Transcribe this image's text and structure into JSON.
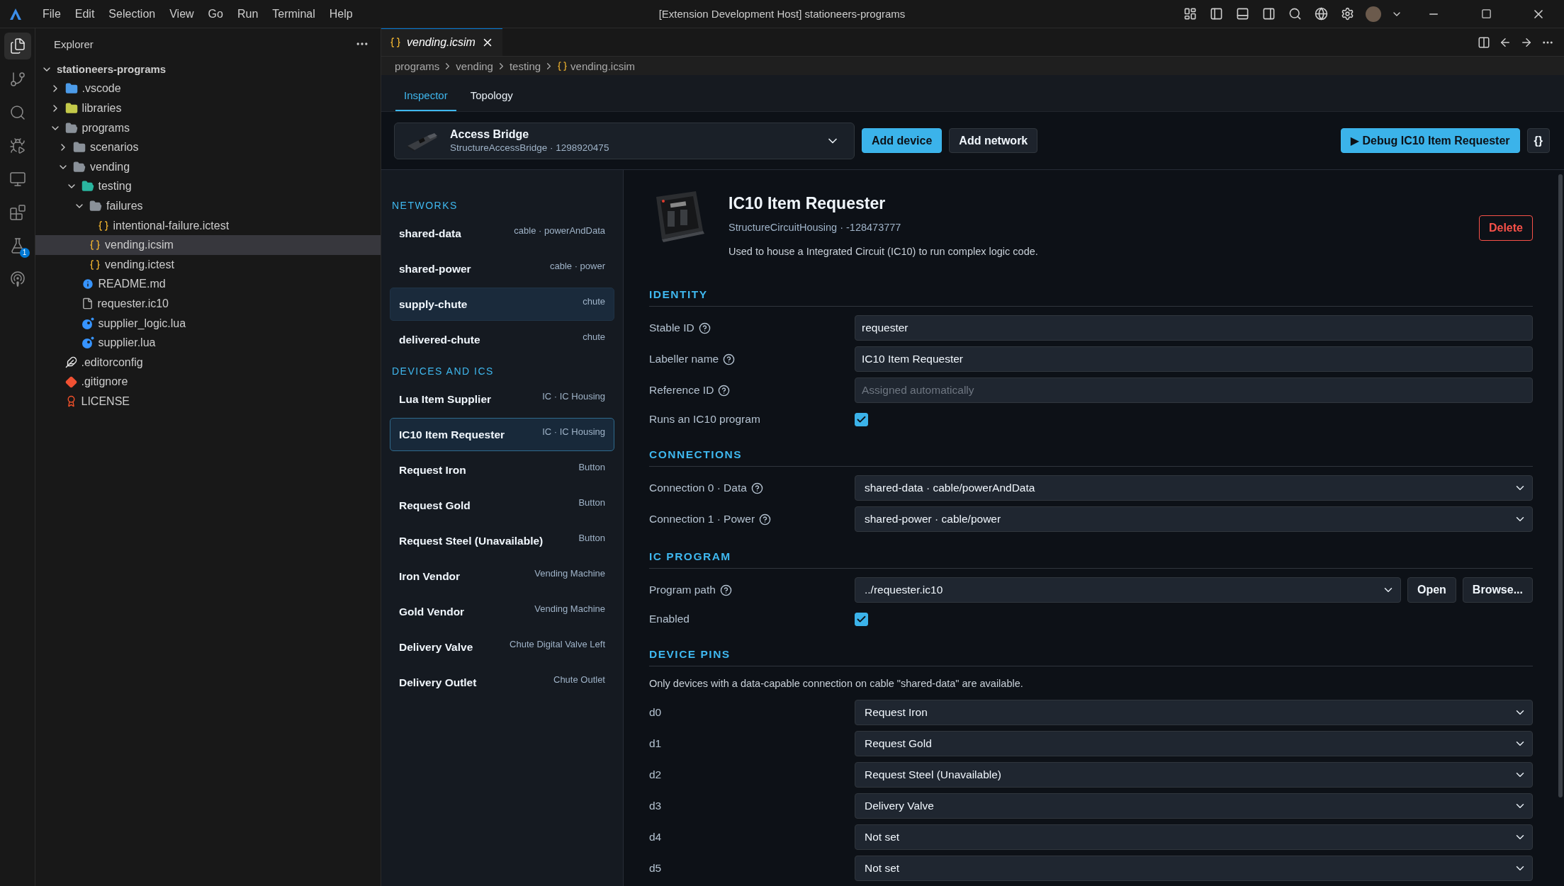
{
  "title_bar": {
    "menu": [
      "File",
      "Edit",
      "Selection",
      "View",
      "Go",
      "Run",
      "Terminal",
      "Help"
    ],
    "title": "[Extension Development Host] stationeers-programs"
  },
  "activity_bar": [
    {
      "kind": "explorer",
      "selected": true
    },
    {
      "kind": "source-control",
      "selected": false
    },
    {
      "kind": "search",
      "selected": false
    },
    {
      "kind": "run-debug",
      "selected": false
    },
    {
      "kind": "remote",
      "selected": false
    },
    {
      "kind": "extensions",
      "selected": false
    },
    {
      "kind": "testing",
      "selected": false,
      "badge": "1"
    },
    {
      "kind": "broadcast",
      "selected": false
    }
  ],
  "explorer": {
    "title": "Explorer",
    "tree": [
      {
        "name": "stationeers-programs",
        "kind": "root",
        "expanded": true,
        "selected": false,
        "children": [
          {
            "name": ".vscode",
            "kind": "vscode-folder",
            "expanded": false,
            "selected": false
          },
          {
            "name": "libraries",
            "kind": "library-folder",
            "expanded": false,
            "selected": false
          },
          {
            "name": "programs",
            "kind": "folder",
            "expanded": true,
            "selected": false,
            "children": [
              {
                "name": "scenarios",
                "kind": "folder",
                "expanded": false,
                "selected": false
              },
              {
                "name": "vending",
                "kind": "folder",
                "expanded": true,
                "selected": false,
                "children": [
                  {
                    "name": "testing",
                    "kind": "test-folder",
                    "expanded": true,
                    "selected": false,
                    "children": [
                      {
                        "name": "failures",
                        "kind": "folder",
                        "expanded": true,
                        "selected": false,
                        "children": [
                          {
                            "name": "intentional-failure.ictest",
                            "kind": "json-file",
                            "selected": false
                          }
                        ]
                      },
                      {
                        "name": "vending.icsim",
                        "kind": "json-file",
                        "selected": true
                      },
                      {
                        "name": "vending.ictest",
                        "kind": "json-file",
                        "selected": false
                      }
                    ]
                  },
                  {
                    "name": "README.md",
                    "kind": "info-file",
                    "selected": false
                  },
                  {
                    "name": "requester.ic10",
                    "kind": "text-file",
                    "selected": false
                  },
                  {
                    "name": "supplier_logic.lua",
                    "kind": "lua-file",
                    "selected": false
                  },
                  {
                    "name": "supplier.lua",
                    "kind": "lua-file",
                    "selected": false
                  }
                ]
              }
            ]
          },
          {
            "name": ".editorconfig",
            "kind": "config-file",
            "selected": false
          },
          {
            "name": ".gitignore",
            "kind": "git-file",
            "selected": false
          },
          {
            "name": "LICENSE",
            "kind": "license-file",
            "selected": false
          }
        ]
      }
    ]
  },
  "editor": {
    "tabs": [
      {
        "label": "vending.icsim",
        "selected": true
      }
    ],
    "breadcrumb": [
      "programs",
      "vending",
      "testing",
      "vending.icsim"
    ]
  },
  "inspector": {
    "tabs": [
      {
        "label": "Inspector",
        "selected": true
      },
      {
        "label": "Topology",
        "selected": false
      }
    ],
    "device_picker": {
      "name": "Access Bridge",
      "subtitle": "StructureAccessBridge · 1298920475"
    },
    "toolbar_buttons": [
      {
        "label": "Add device",
        "kind": "primary"
      },
      {
        "label": "Add network",
        "kind": "secondary"
      }
    ],
    "debug_button": "▶ Debug IC10 Item Requester",
    "json_button": "{}",
    "lists": [
      {
        "heading": "NETWORKS",
        "items": [
          {
            "name": "shared-data",
            "meta": "cable · powerAndData",
            "selected": false,
            "hovered": false
          },
          {
            "name": "shared-power",
            "meta": "cable · power",
            "selected": false,
            "hovered": false
          },
          {
            "name": "supply-chute",
            "meta": "chute",
            "selected": false,
            "hovered": true
          },
          {
            "name": "delivered-chute",
            "meta": "chute",
            "selected": false,
            "hovered": false
          }
        ]
      },
      {
        "heading": "DEVICES AND ICS",
        "items": [
          {
            "name": "Lua Item Supplier",
            "meta": "IC · IC Housing",
            "selected": false,
            "hovered": false
          },
          {
            "name": "IC10 Item Requester",
            "meta": "IC · IC Housing",
            "selected": true,
            "hovered": false
          },
          {
            "name": "Request Iron",
            "meta": "Button",
            "selected": false,
            "hovered": false
          },
          {
            "name": "Request Gold",
            "meta": "Button",
            "selected": false,
            "hovered": false
          },
          {
            "name": "Request Steel (Unavailable)",
            "meta": "Button",
            "selected": false,
            "hovered": false
          },
          {
            "name": "Iron Vendor",
            "meta": "Vending Machine",
            "selected": false,
            "hovered": false
          },
          {
            "name": "Gold Vendor",
            "meta": "Vending Machine",
            "selected": false,
            "hovered": false
          },
          {
            "name": "Delivery Valve",
            "meta": "Chute Digital Valve Left",
            "selected": false,
            "hovered": false
          },
          {
            "name": "Delivery Outlet",
            "meta": "Chute Outlet",
            "selected": false,
            "hovered": false
          }
        ]
      }
    ],
    "detail": {
      "title": "IC10 Item Requester",
      "subtitle": "StructureCircuitHousing · -128473777",
      "description": "Used to house a Integrated Circuit (IC10) to run complex logic code.",
      "delete_button": "Delete",
      "sections": [
        {
          "heading": "IDENTITY",
          "fields": [
            {
              "label": "Stable ID",
              "help": true,
              "kind": "text",
              "value": "requester"
            },
            {
              "label": "Labeller name",
              "help": true,
              "kind": "text",
              "value": "IC10 Item Requester"
            },
            {
              "label": "Reference ID",
              "help": true,
              "kind": "text",
              "placeholder": "Assigned automatically"
            },
            {
              "label": "Runs an IC10 program",
              "help": false,
              "kind": "checkbox",
              "checked": true
            }
          ]
        },
        {
          "heading": "CONNECTIONS",
          "fields": [
            {
              "label": "Connection 0 · Data",
              "help": true,
              "kind": "select",
              "value": "shared-data · cable/powerAndData"
            },
            {
              "label": "Connection 1 · Power",
              "help": true,
              "kind": "select",
              "value": "shared-power · cable/power"
            }
          ]
        },
        {
          "heading": "IC PROGRAM",
          "fields": [
            {
              "label": "Program path",
              "help": true,
              "kind": "program",
              "value": "../requester.ic10",
              "buttons": [
                "Open",
                "Browse..."
              ]
            },
            {
              "label": "Enabled",
              "help": false,
              "kind": "checkbox",
              "checked": true
            }
          ]
        },
        {
          "heading": "DEVICE PINS",
          "note": "Only devices with a data-capable connection on cable \"shared-data\" are available.",
          "fields": [
            {
              "label": "d0",
              "help": false,
              "kind": "select",
              "value": "Request Iron"
            },
            {
              "label": "d1",
              "help": false,
              "kind": "select",
              "value": "Request Gold"
            },
            {
              "label": "d2",
              "help": false,
              "kind": "select",
              "value": "Request Steel (Unavailable)"
            },
            {
              "label": "d3",
              "help": false,
              "kind": "select",
              "value": "Delivery Valve"
            },
            {
              "label": "d4",
              "help": false,
              "kind": "select",
              "value": "Not set"
            },
            {
              "label": "d5",
              "help": false,
              "kind": "select",
              "value": "Not set"
            }
          ]
        }
      ]
    }
  }
}
